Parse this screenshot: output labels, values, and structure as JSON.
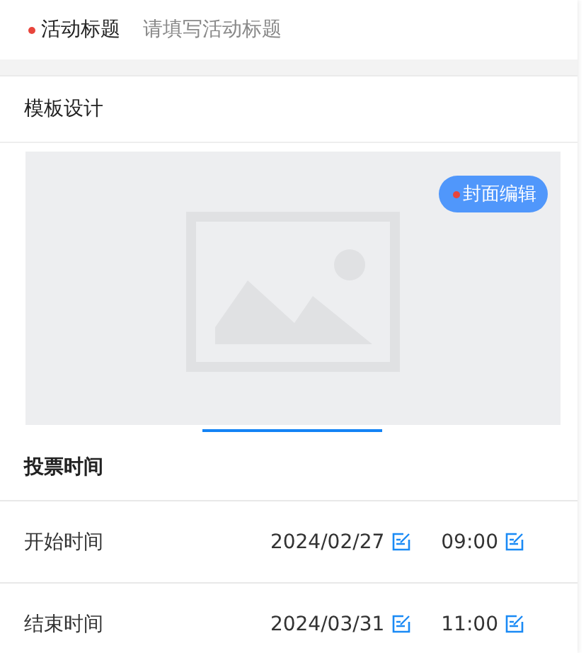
{
  "title_field": {
    "label": "活动标题",
    "required": true,
    "placeholder": "请填写活动标题"
  },
  "template": {
    "heading": "模板设计",
    "cover": {
      "kind": "picture",
      "button": {
        "label": "封面编辑",
        "required": true
      }
    }
  },
  "vote_time": {
    "heading": "投票时间",
    "rows": [
      {
        "label": "开始时间",
        "date": "2024/02/27",
        "time": "09:00"
      },
      {
        "label": "结束时间",
        "date": "2024/03/31",
        "time": "11:00"
      }
    ]
  }
}
